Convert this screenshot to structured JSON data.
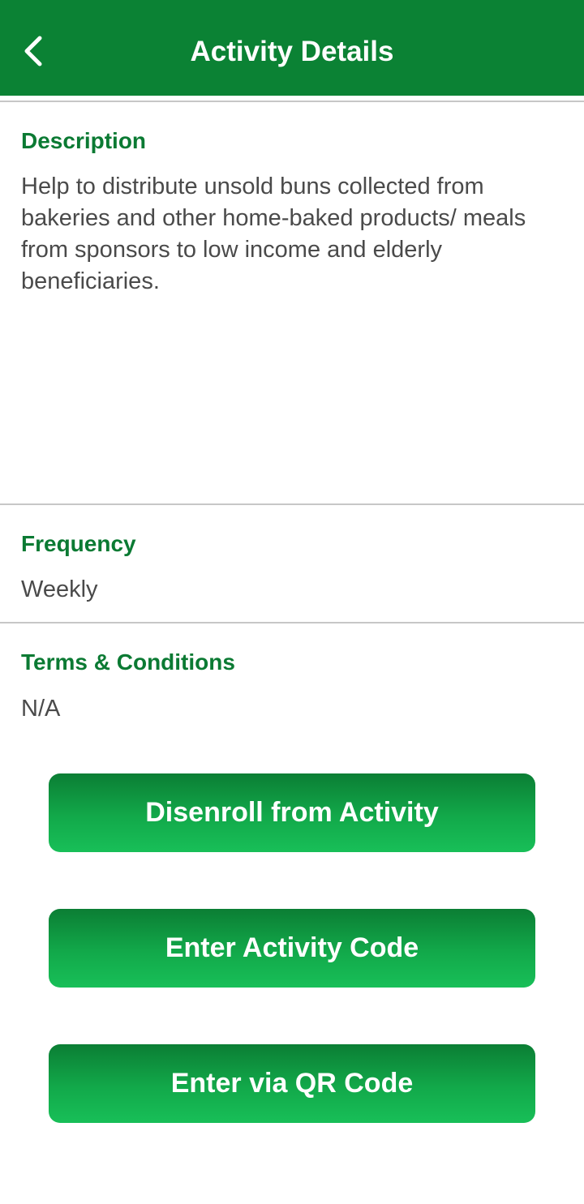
{
  "header": {
    "title": "Activity Details",
    "back_icon": "chevron-left-icon"
  },
  "description": {
    "label": "Description",
    "text": "Help to distribute unsold buns collected from bakeries and other home-baked products/ meals from sponsors to low income and elderly beneficiaries."
  },
  "frequency": {
    "label": "Frequency",
    "value": "Weekly"
  },
  "terms": {
    "label": "Terms & Conditions",
    "value": "N/A"
  },
  "buttons": {
    "disenroll": "Disenroll from Activity",
    "activity_code": "Enter Activity Code",
    "qr_code": "Enter via QR Code"
  },
  "colors": {
    "app_bar": "#0b8234",
    "label_green": "#0b7a33",
    "button_top": "#0b7e34",
    "button_bottom": "#18bf58"
  }
}
